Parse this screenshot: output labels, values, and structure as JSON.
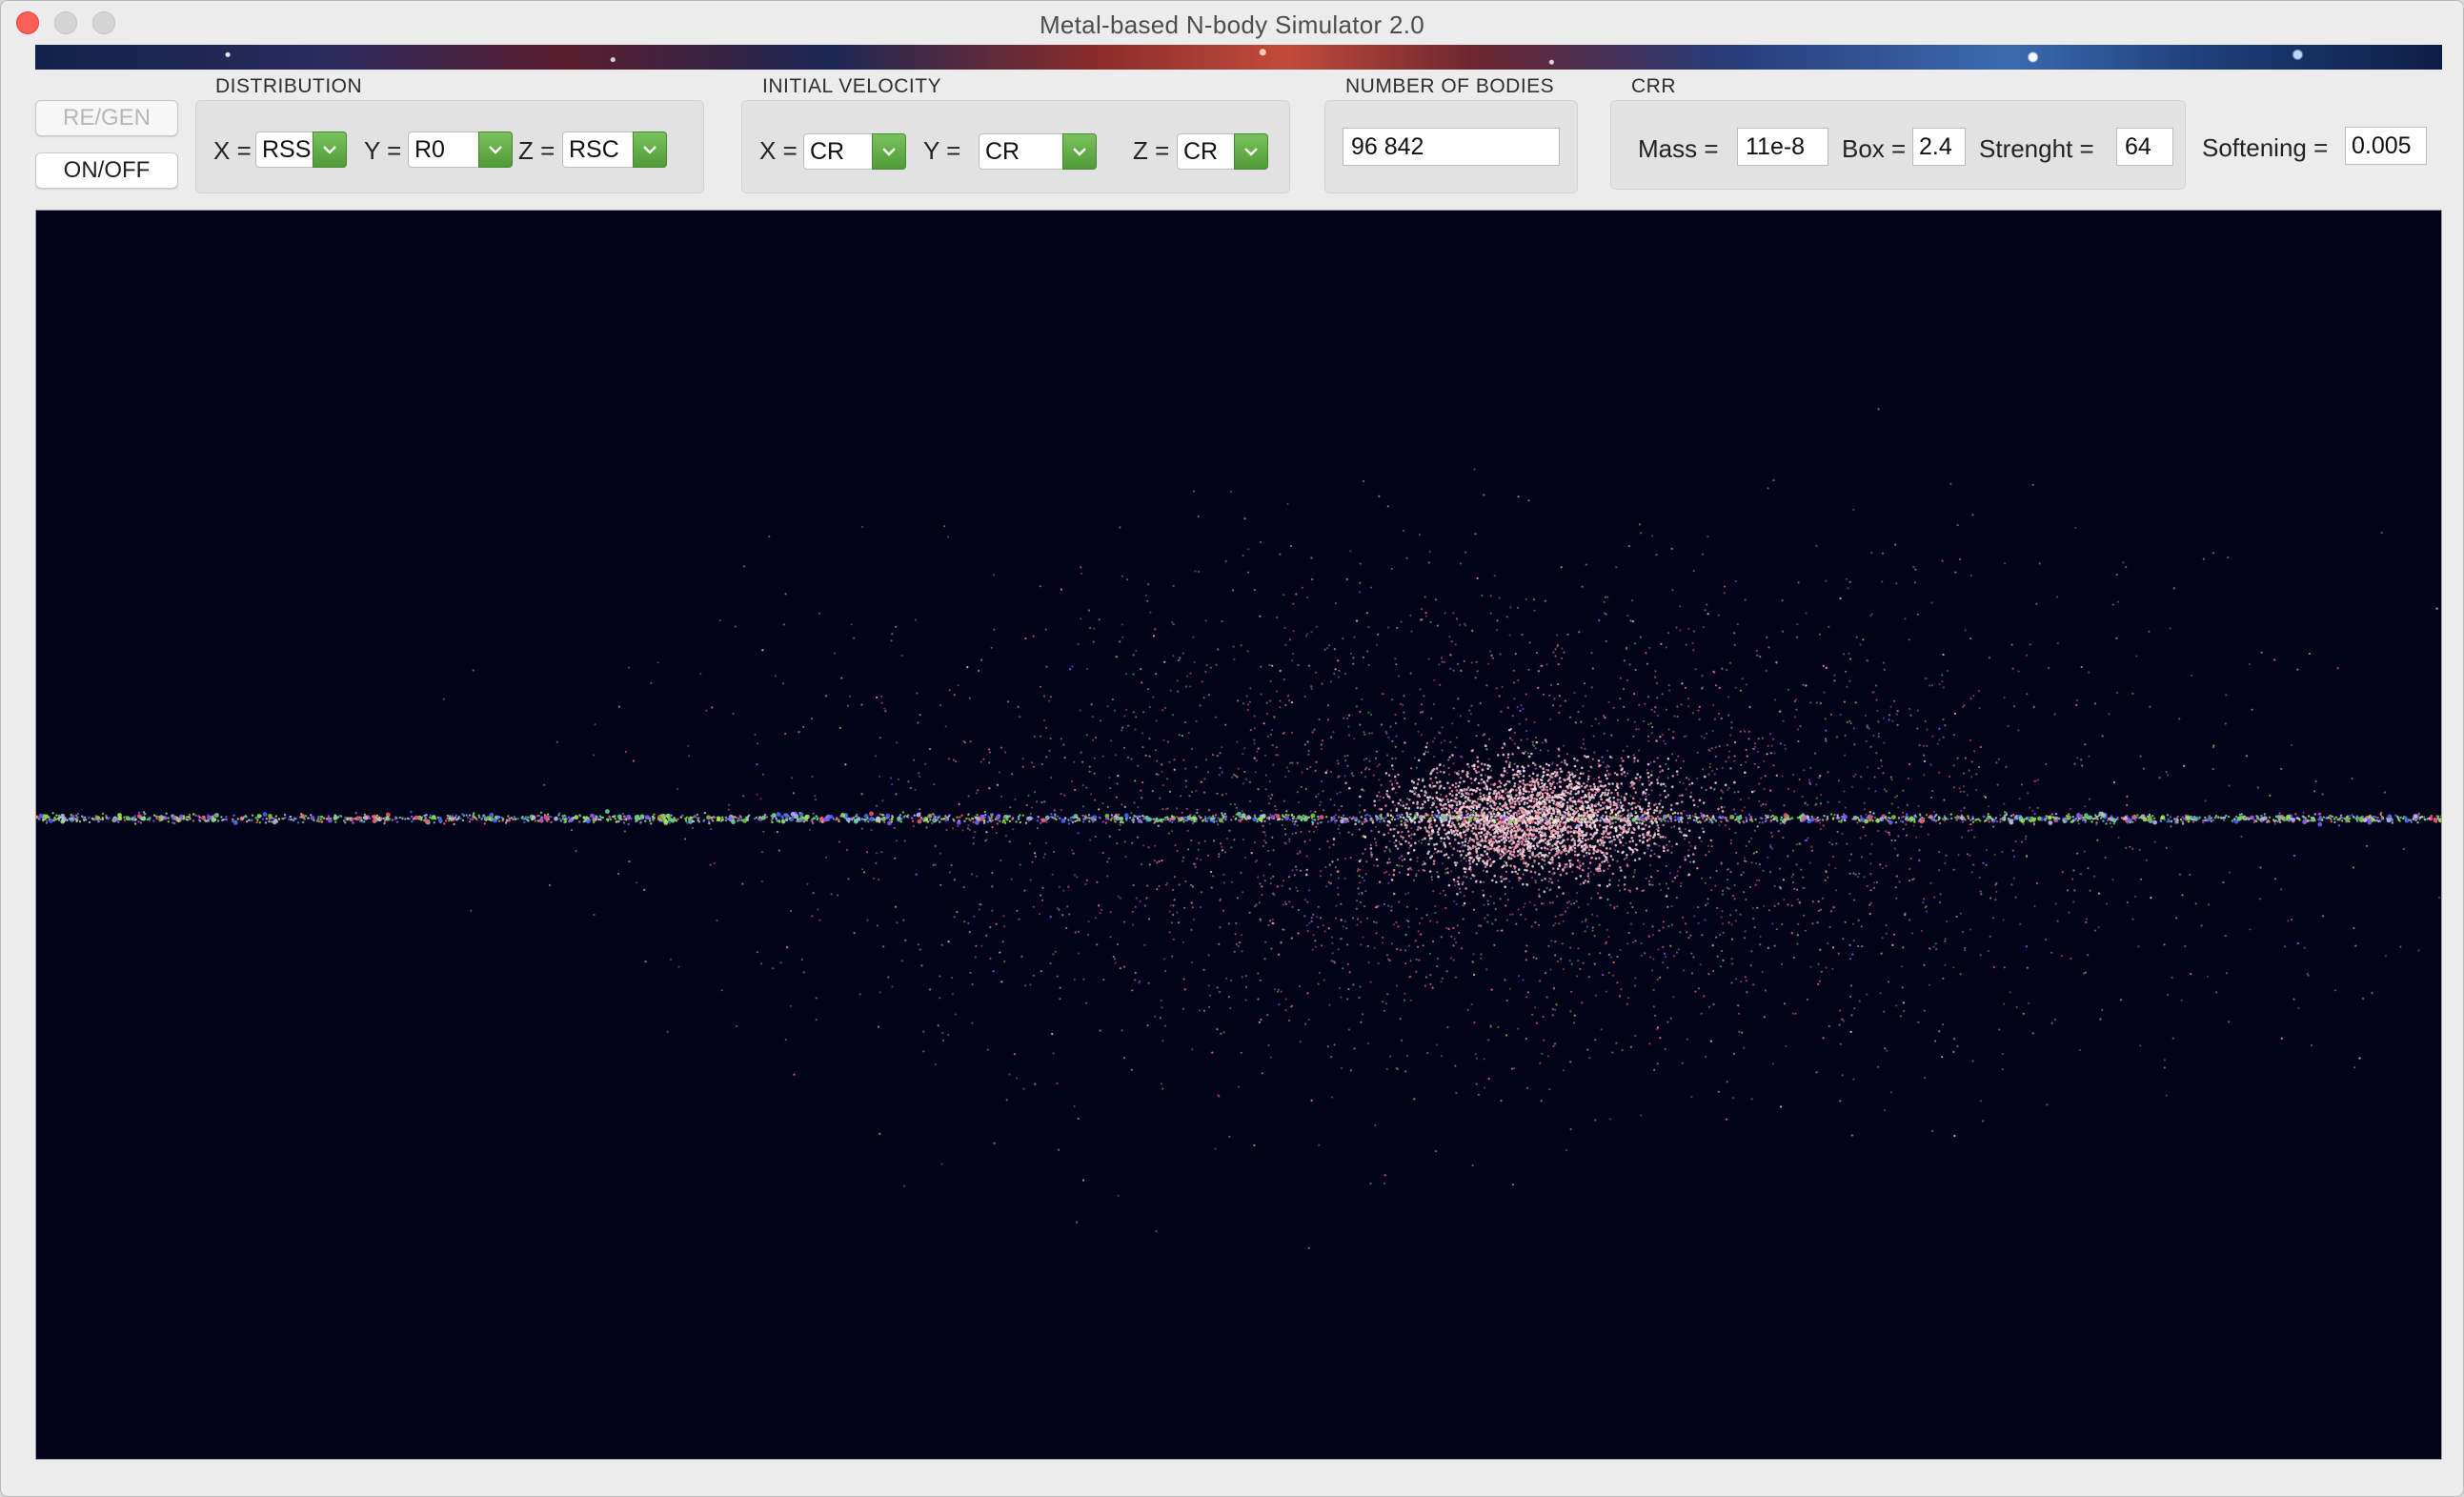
{
  "window": {
    "title": "Metal-based N-body Simulator 2.0",
    "controls": [
      "close-icon",
      "minimize-icon",
      "zoom-icon"
    ]
  },
  "buttons": {
    "regen": "RE/GEN",
    "onoff": "ON/OFF"
  },
  "distribution": {
    "label": "DISTRIBUTION",
    "x": {
      "prefix": "X =",
      "value": "RSS"
    },
    "y": {
      "prefix": "Y =",
      "value": "R0"
    },
    "z": {
      "prefix": "Z =",
      "value": "RSC"
    }
  },
  "initial_velocity": {
    "label": "INITIAL VELOCITY",
    "x": {
      "prefix": "X =",
      "value": "CR"
    },
    "y": {
      "prefix": "Y =",
      "value": "CR"
    },
    "z": {
      "prefix": "Z =",
      "value": "CR"
    }
  },
  "number_of_bodies": {
    "label": "NUMBER OF BODIES",
    "value": "96 842"
  },
  "crr": {
    "label": "CRR",
    "mass": {
      "prefix": "Mass =",
      "value": "11e-8"
    },
    "box": {
      "prefix": "Box =",
      "value": "2.4"
    },
    "strength": {
      "prefix": "Strenght =",
      "value": "64"
    },
    "softening": {
      "prefix": "Softening =",
      "value": "0.005"
    }
  },
  "colors": {
    "accent_green": "#5aa93f",
    "viewport_bg": "#020219",
    "close_red": "#fc5f57"
  }
}
